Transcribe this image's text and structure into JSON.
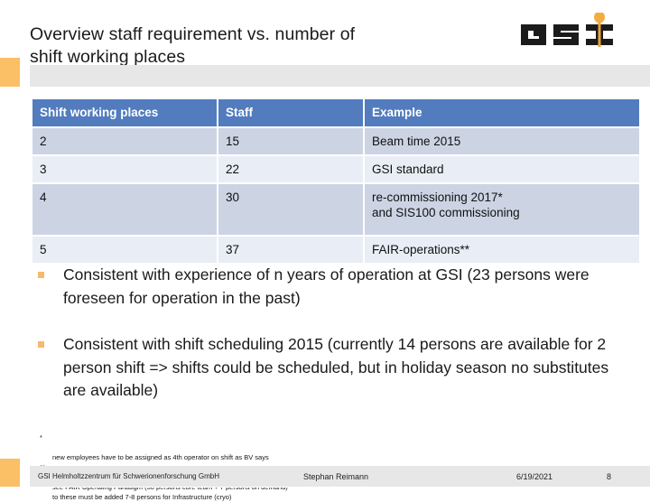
{
  "header": {
    "title": "Overview staff requirement vs. number of\nshift working places",
    "logo": {
      "name": "gsi-logo",
      "letters": "GSI"
    },
    "accent_color": "#fbbf66",
    "band_color": "#e7e7e8"
  },
  "table": {
    "header_color": "#527cbe",
    "row_dark_color": "#ccd4e4",
    "row_light_color": "#e9edf5",
    "columns": [
      "Shift working places",
      "Staff",
      "Example"
    ],
    "rows": [
      {
        "shift_working_places": "2",
        "staff": "15",
        "example": "Beam time 2015"
      },
      {
        "shift_working_places": "3",
        "staff": "22",
        "example": "GSI standard"
      },
      {
        "shift_working_places": "4",
        "staff": "30",
        "example": "re-commissioning 2017* \nand SIS100 commissioning"
      },
      {
        "shift_working_places": "5",
        "staff": "37",
        "example": "FAIR-operations**"
      }
    ]
  },
  "bullets": [
    "Consistent with experience of n years of operation at GSI (23 persons were foreseen for operation in the past)",
    "Consistent with shift scheduling 2015 (currently 14 persons are available for 2 person shift => shifts could be scheduled, but in holiday season no substitutes are available)"
  ],
  "footnotes": [
    {
      "marker": "*",
      "text": "new employees have to be assigned as 4th operator on shift as BV says"
    },
    {
      "marker": "**",
      "text": "see FAIR Operating Paradigm (30 persons core team + 7 persons on demand)\n  to these must be added 7-8 persons for Infrastructure (cryo)"
    }
  ],
  "footer": {
    "organization": "GSI Helmholtzzentrum für Schwerionenforschung GmbH",
    "author": "Stephan Reimann",
    "date": "6/19/2021",
    "page_number": "8"
  }
}
